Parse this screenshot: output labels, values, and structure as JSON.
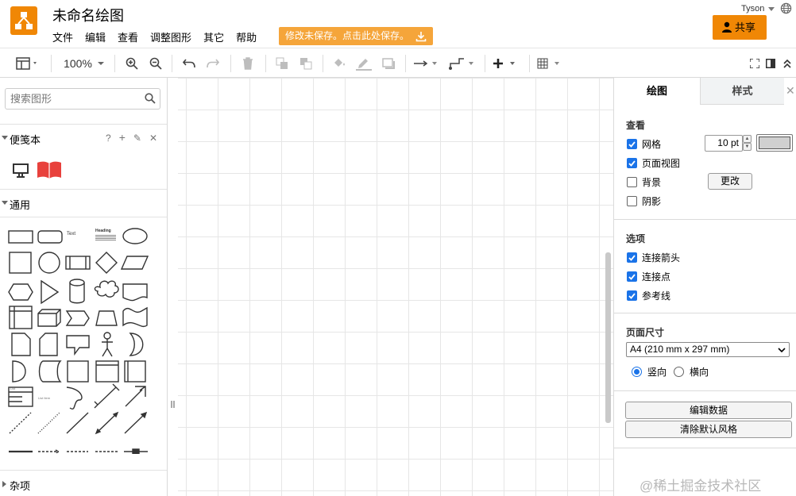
{
  "app": {
    "title": "未命名绘图",
    "menu": [
      "文件",
      "编辑",
      "查看",
      "调整图形",
      "其它",
      "帮助"
    ],
    "unsaved_notice": "修改未保存。点击此处保存。",
    "user": "Tyson",
    "share_label": "共享",
    "brand_color": "#f08705"
  },
  "toolbar": {
    "zoom": "100%"
  },
  "sidebar": {
    "search_placeholder": "搜索图形",
    "scratchpad": {
      "label": "便笺本",
      "help": "?",
      "add": "+",
      "edit": "✎",
      "close": "✕"
    },
    "general": {
      "label": "通用"
    },
    "misc": {
      "label": "杂项"
    },
    "shapes": {
      "text_label": "Text",
      "heading_label": "Heading",
      "list_label": "List",
      "list_item_label": "List Item"
    }
  },
  "panel": {
    "tabs": [
      "绘图",
      "样式"
    ],
    "view": {
      "title": "查看",
      "grid": {
        "label": "网格",
        "checked": true,
        "size": "10 pt",
        "color": "#d0d0d0"
      },
      "page_view": {
        "label": "页面视图",
        "checked": true
      },
      "background": {
        "label": "背景",
        "checked": false,
        "button": "更改"
      },
      "shadow": {
        "label": "阴影",
        "checked": false
      }
    },
    "options": {
      "title": "选项",
      "items": [
        {
          "label": "连接箭头",
          "checked": true
        },
        {
          "label": "连接点",
          "checked": true
        },
        {
          "label": "参考线",
          "checked": true
        }
      ]
    },
    "page_size": {
      "title": "页面尺寸",
      "selected": "A4 (210 mm x 297 mm)",
      "portrait": "竖向",
      "landscape": "横向",
      "orientation": "portrait"
    },
    "edit_data": "编辑数据",
    "clear_default_style": "清除默认风格"
  },
  "watermark": "@稀土掘金技术社区"
}
